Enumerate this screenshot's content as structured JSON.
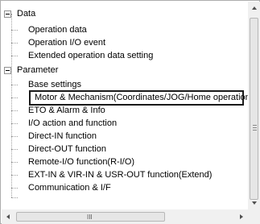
{
  "tree": {
    "data": {
      "label": "Data",
      "children": [
        "Operation data",
        "Operation I/O event",
        "Extended operation data setting"
      ]
    },
    "parameter": {
      "label": "Parameter",
      "children": [
        "Base settings",
        "Motor & Mechanism(Coordinates/JOG/Home operation)",
        "ETO & Alarm & Info",
        "I/O action and function",
        "Direct-IN function",
        "Direct-OUT function",
        "Remote-I/O function(R-I/O)",
        "EXT-IN & VIR-IN & USR-OUT function(Extend)",
        "Communication & I/F"
      ]
    }
  },
  "scrollbars": {
    "horizontal_grip": "III"
  }
}
